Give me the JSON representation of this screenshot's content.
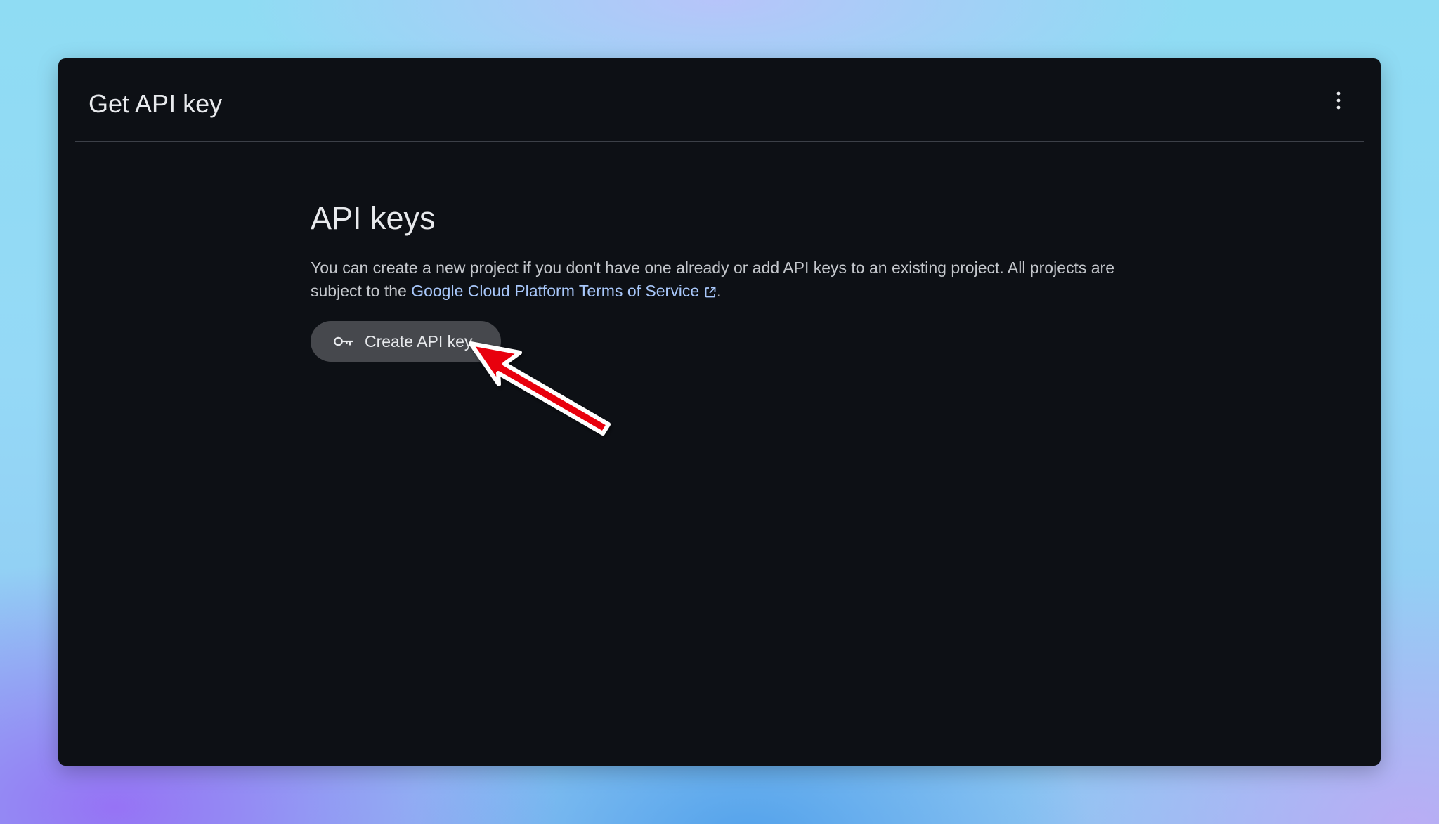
{
  "header": {
    "title": "Get API key",
    "menu_icon": "more-vert-icon"
  },
  "main": {
    "title": "API keys",
    "description_before_link": "You can create a new project if you don't have one already or add API keys to an existing project. All projects are subject to the ",
    "link_text": "Google Cloud Platform Terms of Service",
    "link_icon": "external-link-icon",
    "description_after_link": ".",
    "create_button": {
      "label": "Create API key",
      "icon": "key-icon"
    }
  },
  "annotation": {
    "type": "arrow",
    "points_to": "create-api-key-button",
    "color": "#e8000b"
  },
  "colors": {
    "window_background": "#0d1015",
    "link": "#a8c7fa",
    "button_background": "#46484d",
    "text_primary": "#e8eaed",
    "text_secondary": "#c4c7cc"
  }
}
